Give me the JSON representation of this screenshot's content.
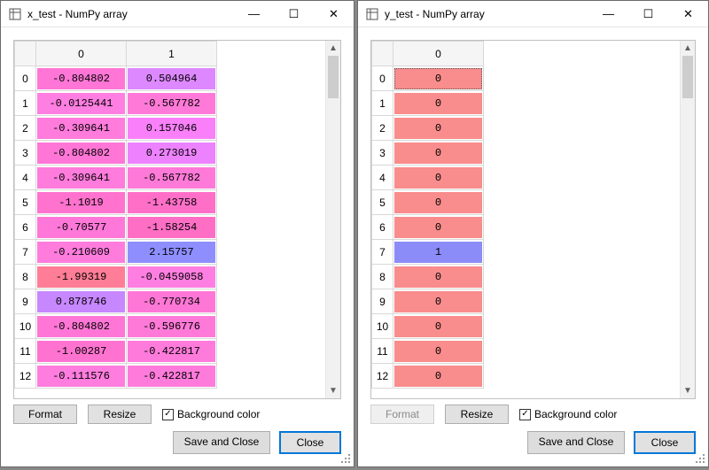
{
  "left": {
    "title": "x_test - NumPy array",
    "col_headers": [
      "0",
      "1"
    ],
    "rows": [
      {
        "idx": "0",
        "cells": [
          {
            "v": "-0.804802",
            "bg": "#ff76d6"
          },
          {
            "v": "0.504964",
            "bg": "#dd88ff"
          }
        ]
      },
      {
        "idx": "1",
        "cells": [
          {
            "v": "-0.0125441",
            "bg": "#ff7ee1"
          },
          {
            "v": "-0.567782",
            "bg": "#ff7ad8"
          }
        ]
      },
      {
        "idx": "2",
        "cells": [
          {
            "v": "-0.309641",
            "bg": "#ff7bdc"
          },
          {
            "v": "0.157046",
            "bg": "#f980f9"
          }
        ]
      },
      {
        "idx": "3",
        "cells": [
          {
            "v": "-0.804802",
            "bg": "#ff76d6"
          },
          {
            "v": "0.273019",
            "bg": "#ed82ff"
          }
        ]
      },
      {
        "idx": "4",
        "cells": [
          {
            "v": "-0.309641",
            "bg": "#ff7bdc"
          },
          {
            "v": "-0.567782",
            "bg": "#ff7ad8"
          }
        ]
      },
      {
        "idx": "5",
        "cells": [
          {
            "v": "-1.1019",
            "bg": "#ff72ce"
          },
          {
            "v": "-1.43758",
            "bg": "#ff6fc8"
          }
        ]
      },
      {
        "idx": "6",
        "cells": [
          {
            "v": "-0.70577",
            "bg": "#ff77d8"
          },
          {
            "v": "-1.58254",
            "bg": "#ff6ec5"
          }
        ]
      },
      {
        "idx": "7",
        "cells": [
          {
            "v": "-0.210609",
            "bg": "#ff7cdd"
          },
          {
            "v": "2.15757",
            "bg": "#8e8eff"
          }
        ]
      },
      {
        "idx": "8",
        "cells": [
          {
            "v": "-1.99319",
            "bg": "#ff7d96"
          },
          {
            "v": "-0.0459058",
            "bg": "#ff7ee1"
          }
        ]
      },
      {
        "idx": "9",
        "cells": [
          {
            "v": "0.878746",
            "bg": "#c787ff"
          },
          {
            "v": "-0.770734",
            "bg": "#ff77d6"
          }
        ]
      },
      {
        "idx": "10",
        "cells": [
          {
            "v": "-0.804802",
            "bg": "#ff76d6"
          },
          {
            "v": "-0.596776",
            "bg": "#ff79d8"
          }
        ]
      },
      {
        "idx": "11",
        "cells": [
          {
            "v": "-1.00287",
            "bg": "#ff73d0"
          },
          {
            "v": "-0.422817",
            "bg": "#ff7bdb"
          }
        ]
      },
      {
        "idx": "12",
        "cells": [
          {
            "v": "-0.111576",
            "bg": "#ff7dde"
          },
          {
            "v": "-0.422817",
            "bg": "#ff7bdb"
          }
        ]
      }
    ],
    "format_enabled": true,
    "buttons": {
      "format": "Format",
      "resize": "Resize",
      "bg_label": "Background color",
      "save": "Save and Close",
      "close": "Close"
    }
  },
  "right": {
    "title": "y_test - NumPy array",
    "col_headers": [
      "0"
    ],
    "rows": [
      {
        "idx": "0",
        "cells": [
          {
            "v": "0",
            "bg": "#f98c8c"
          }
        ],
        "dotted": true
      },
      {
        "idx": "1",
        "cells": [
          {
            "v": "0",
            "bg": "#f98c8c"
          }
        ]
      },
      {
        "idx": "2",
        "cells": [
          {
            "v": "0",
            "bg": "#f98c8c"
          }
        ]
      },
      {
        "idx": "3",
        "cells": [
          {
            "v": "0",
            "bg": "#f98c8c"
          }
        ]
      },
      {
        "idx": "4",
        "cells": [
          {
            "v": "0",
            "bg": "#f98c8c"
          }
        ]
      },
      {
        "idx": "5",
        "cells": [
          {
            "v": "0",
            "bg": "#f98c8c"
          }
        ]
      },
      {
        "idx": "6",
        "cells": [
          {
            "v": "0",
            "bg": "#f98c8c"
          }
        ]
      },
      {
        "idx": "7",
        "cells": [
          {
            "v": "1",
            "bg": "#8c8cf9"
          }
        ]
      },
      {
        "idx": "8",
        "cells": [
          {
            "v": "0",
            "bg": "#f98c8c"
          }
        ]
      },
      {
        "idx": "9",
        "cells": [
          {
            "v": "0",
            "bg": "#f98c8c"
          }
        ]
      },
      {
        "idx": "10",
        "cells": [
          {
            "v": "0",
            "bg": "#f98c8c"
          }
        ]
      },
      {
        "idx": "11",
        "cells": [
          {
            "v": "0",
            "bg": "#f98c8c"
          }
        ]
      },
      {
        "idx": "12",
        "cells": [
          {
            "v": "0",
            "bg": "#f98c8c"
          }
        ]
      }
    ],
    "format_enabled": false,
    "buttons": {
      "format": "Format",
      "resize": "Resize",
      "bg_label": "Background color",
      "save": "Save and Close",
      "close": "Close"
    }
  },
  "glyphs": {
    "min": "—",
    "max": "☐",
    "close": "✕",
    "check": "✓",
    "up": "▲",
    "down": "▼"
  }
}
